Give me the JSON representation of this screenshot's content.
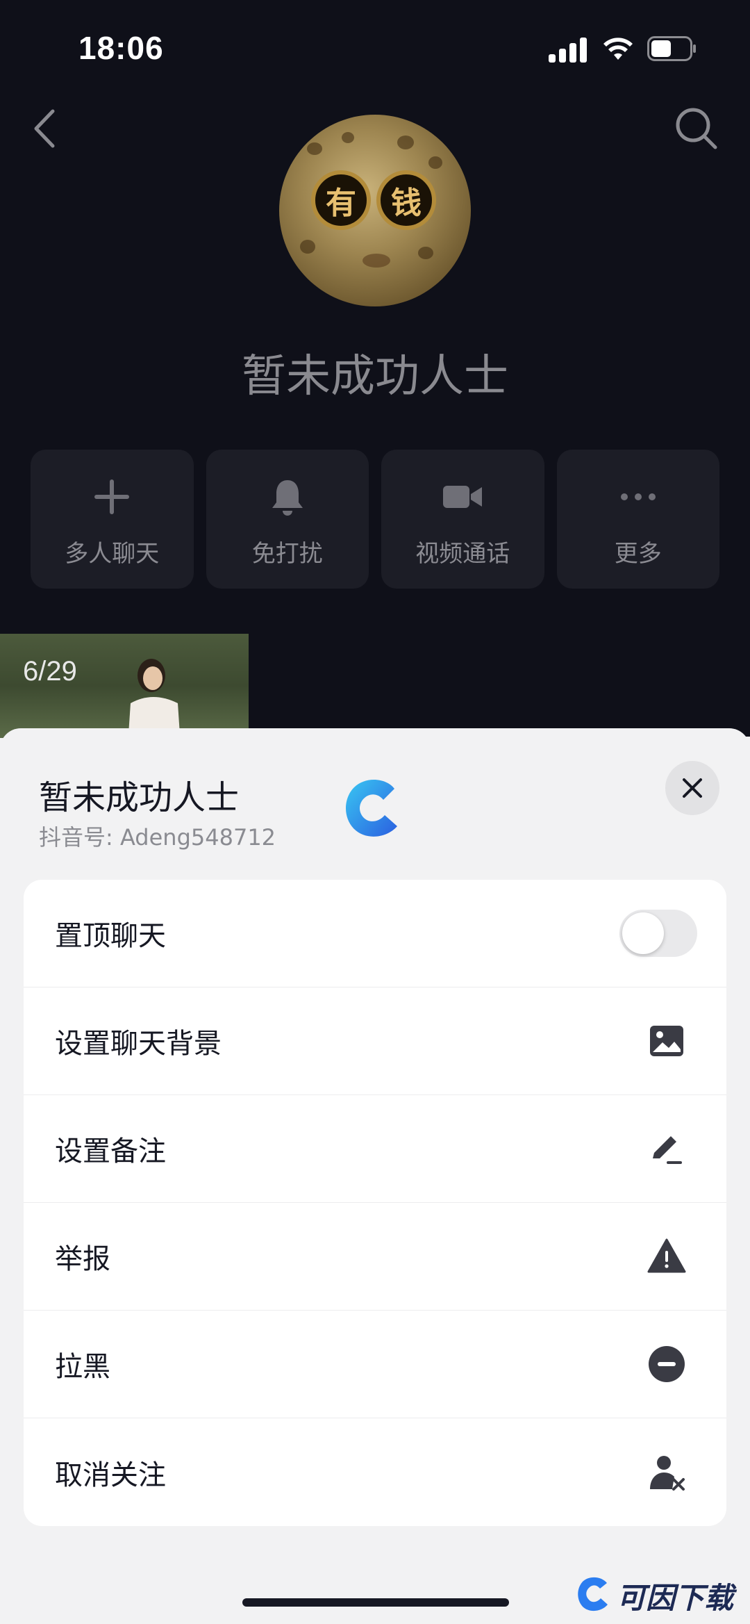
{
  "status": {
    "time": "18:06"
  },
  "profile": {
    "name": "暂未成功人士",
    "avatar_glasses": [
      "有",
      "钱"
    ]
  },
  "actions": [
    {
      "label": "多人聊天",
      "icon": "plus-icon"
    },
    {
      "label": "免打扰",
      "icon": "bell-icon"
    },
    {
      "label": "视频通话",
      "icon": "video-camera-icon"
    },
    {
      "label": "更多",
      "icon": "more-dots-icon"
    }
  ],
  "media": {
    "counter": "6/29"
  },
  "sheet": {
    "title": "暂未成功人士",
    "subtitle": "抖音号: Adeng548712",
    "items": [
      {
        "label": "置顶聊天",
        "control": "toggle",
        "toggle_on": false
      },
      {
        "label": "设置聊天背景",
        "icon": "image-icon"
      },
      {
        "label": "设置备注",
        "icon": "pencil-icon"
      },
      {
        "label": "举报",
        "icon": "warning-icon"
      },
      {
        "label": "拉黑",
        "icon": "block-icon"
      },
      {
        "label": "取消关注",
        "icon": "user-remove-icon"
      }
    ]
  },
  "watermark": {
    "text": "可因下载"
  },
  "colors": {
    "dark_bg": "#0f1019",
    "sheet_bg": "#f2f2f3",
    "text": "#161823",
    "brand_blue": "#2b7df0"
  }
}
